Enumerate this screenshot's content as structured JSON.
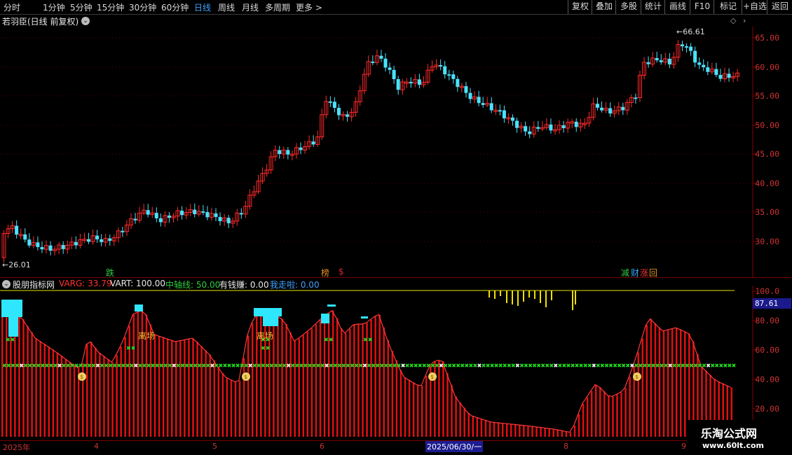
{
  "toolbar": {
    "periods": [
      "分时",
      "1分钟",
      "5分钟",
      "15分钟",
      "30分钟",
      "60分钟",
      "日线",
      "周线",
      "月线",
      "多周期",
      "更多"
    ],
    "active": "日线",
    "right_buttons": [
      "复权",
      "叠加",
      "多股",
      "统计",
      "画线",
      "F10",
      "+自选",
      "返回"
    ],
    "more_icon": "chevron-right-icon"
  },
  "main": {
    "title": "若羽臣(日线 前复权)",
    "high_label": "66.61",
    "low_label": "26.01",
    "y_ticks": [
      "65.00",
      "60.00",
      "55.00",
      "50.00",
      "45.00",
      "40.00",
      "35.00",
      "30.00"
    ],
    "markers": [
      {
        "text": "跌",
        "color": "#2ecc40"
      },
      {
        "text": "榜",
        "color": "#e09020"
      },
      {
        "text": "$",
        "color": "#d23"
      },
      {
        "text": "减",
        "color": "#2ecc40"
      },
      {
        "text": "财",
        "color": "#3af"
      },
      {
        "text": "涨",
        "color": "#e33"
      },
      {
        "text": "回",
        "color": "#e09020"
      }
    ],
    "colors": {
      "up": "#ff2a2a",
      "down": "#49e3ff",
      "bg": "#000000",
      "grid": "#5a0000"
    }
  },
  "indicator": {
    "name": "股朋指标网",
    "fields": [
      {
        "label": "VARG: 33.79",
        "color": "#ff3030"
      },
      {
        "label": "VART: 100.00",
        "color": "#e8e8e8"
      },
      {
        "label": "中轴线: 50.00",
        "color": "#2ecc40"
      },
      {
        "label": "有钱赚: 0.00",
        "color": "#e8e8e8"
      },
      {
        "label": "我走啦: 0.00",
        "color": "#3fa0ff"
      }
    ],
    "y_ticks": [
      "100.0",
      "80.00",
      "60.00",
      "40.00",
      "20.00"
    ],
    "current_value": "87.61",
    "tags": [
      "离场",
      "离场"
    ]
  },
  "date_axis": {
    "labels": [
      "2025年",
      "4",
      "5",
      "6",
      "2025/06/30/一",
      "8",
      "9"
    ]
  },
  "watermark": {
    "line1": "乐淘公式网",
    "line2": "www.60lt.com"
  }
}
